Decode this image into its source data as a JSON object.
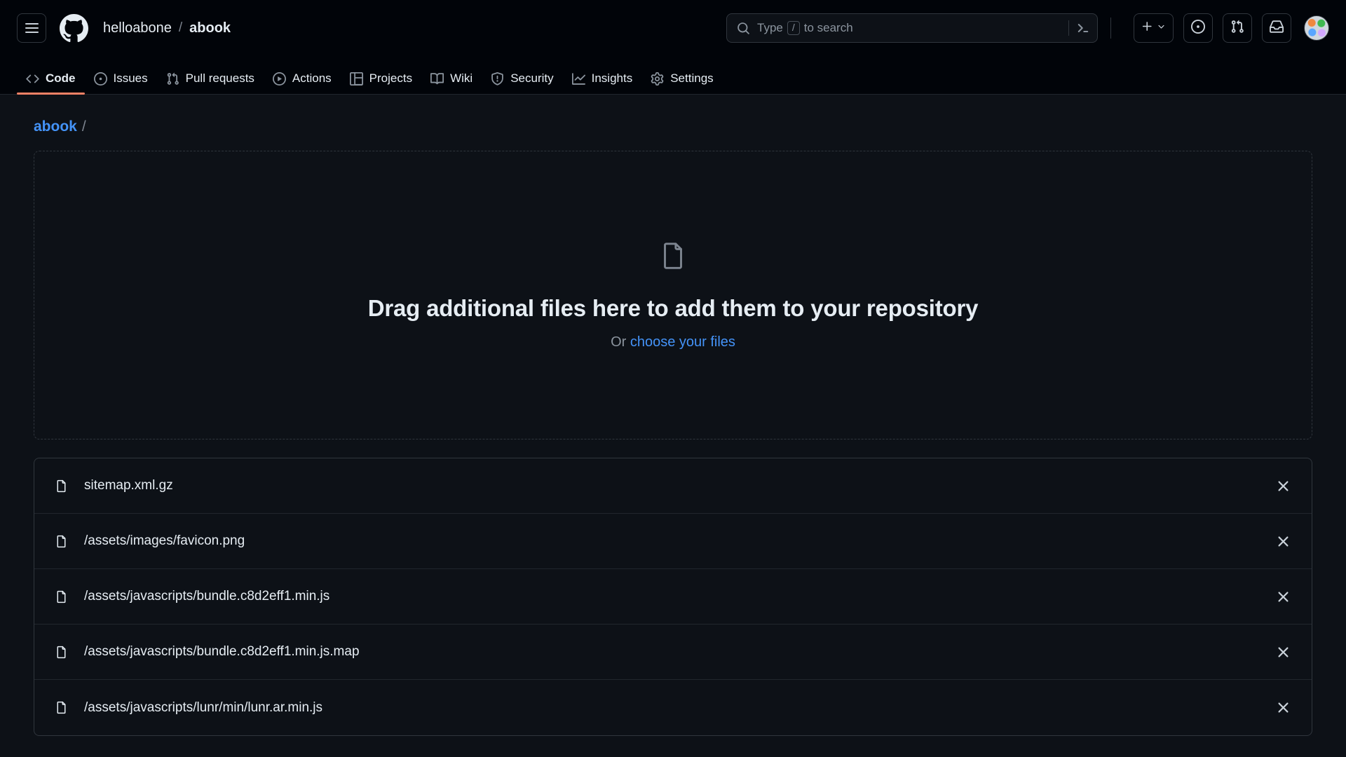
{
  "header": {
    "menu_icon": "hamburger-menu-icon",
    "logo_icon": "github-mark-icon",
    "owner": "helloabone",
    "separator": "/",
    "repo": "abook",
    "search": {
      "icon": "search-icon",
      "placeholder_prefix": "Type",
      "key_hint": "/",
      "placeholder_suffix": "to search",
      "terminal_icon": "command-palette-icon"
    },
    "actions": [
      {
        "name": "create-new-button",
        "icon": "plus-icon",
        "caret": "chevron-down-icon"
      },
      {
        "name": "issues-button",
        "icon": "issue-opened-icon"
      },
      {
        "name": "pull-requests-button",
        "icon": "git-pull-request-icon"
      },
      {
        "name": "notifications-button",
        "icon": "inbox-icon"
      }
    ],
    "avatar_label": "user-avatar"
  },
  "repo_nav": {
    "items": [
      {
        "label": "Code",
        "icon": "code-icon",
        "active": true
      },
      {
        "label": "Issues",
        "icon": "issue-opened-icon",
        "active": false
      },
      {
        "label": "Pull requests",
        "icon": "git-pull-request-icon",
        "active": false
      },
      {
        "label": "Actions",
        "icon": "play-icon",
        "active": false
      },
      {
        "label": "Projects",
        "icon": "table-icon",
        "active": false
      },
      {
        "label": "Wiki",
        "icon": "book-icon",
        "active": false
      },
      {
        "label": "Security",
        "icon": "shield-icon",
        "active": false
      },
      {
        "label": "Insights",
        "icon": "graph-icon",
        "active": false
      },
      {
        "label": "Settings",
        "icon": "gear-icon",
        "active": false
      }
    ],
    "active_indicator_color": "#f78166"
  },
  "breadcrumb": {
    "root": "abook",
    "separator": "/"
  },
  "dropzone": {
    "icon": "file-icon",
    "title": "Drag additional files here to add them to your repository",
    "or_text": "Or",
    "choose_link": "choose your files"
  },
  "files": {
    "remove_icon": "close-icon",
    "items": [
      {
        "icon": "file-icon",
        "name": "sitemap.xml.gz"
      },
      {
        "icon": "file-icon",
        "name": "/assets/images/favicon.png"
      },
      {
        "icon": "file-icon",
        "name": "/assets/javascripts/bundle.c8d2eff1.min.js"
      },
      {
        "icon": "file-icon",
        "name": "/assets/javascripts/bundle.c8d2eff1.min.js.map"
      },
      {
        "icon": "file-icon",
        "name": "/assets/javascripts/lunr/min/lunr.ar.min.js"
      }
    ]
  },
  "colors": {
    "page_bg": "#0d1117",
    "header_bg": "#010409",
    "border": "#30363d",
    "link": "#4493f8",
    "muted": "#8b949e",
    "accent": "#f78166"
  }
}
